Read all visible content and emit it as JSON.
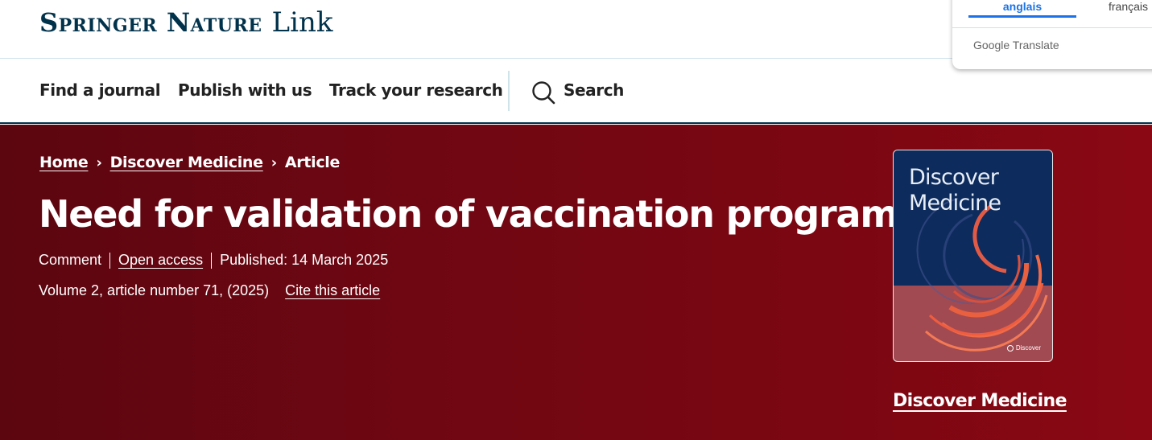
{
  "header": {
    "brand": "Springer Nature",
    "brand_suffix": "Link"
  },
  "nav": {
    "items": [
      "Find a journal",
      "Publish with us",
      "Track your research"
    ],
    "search_label": "Search"
  },
  "translate_popup": {
    "tab_active": "anglais",
    "tab_inactive": "français",
    "brand": "Google Translate"
  },
  "breadcrumb": {
    "home": "Home",
    "journal": "Discover Medicine",
    "current": "Article"
  },
  "article": {
    "title": "Need for validation of vaccination programs",
    "type": "Comment",
    "access": "Open access",
    "published": "Published: 14 March 2025",
    "volume_info": "Volume 2, article number 71, (2025)",
    "cite_label": "Cite this article"
  },
  "cover": {
    "title_line1": "Discover",
    "title_line2": "Medicine",
    "badge": "Discover"
  },
  "journal_link": "Discover Medicine",
  "colors": {
    "brand_navy": "#01324b",
    "hero_red": "#7c0712",
    "accent_blue": "#1a73e8"
  }
}
